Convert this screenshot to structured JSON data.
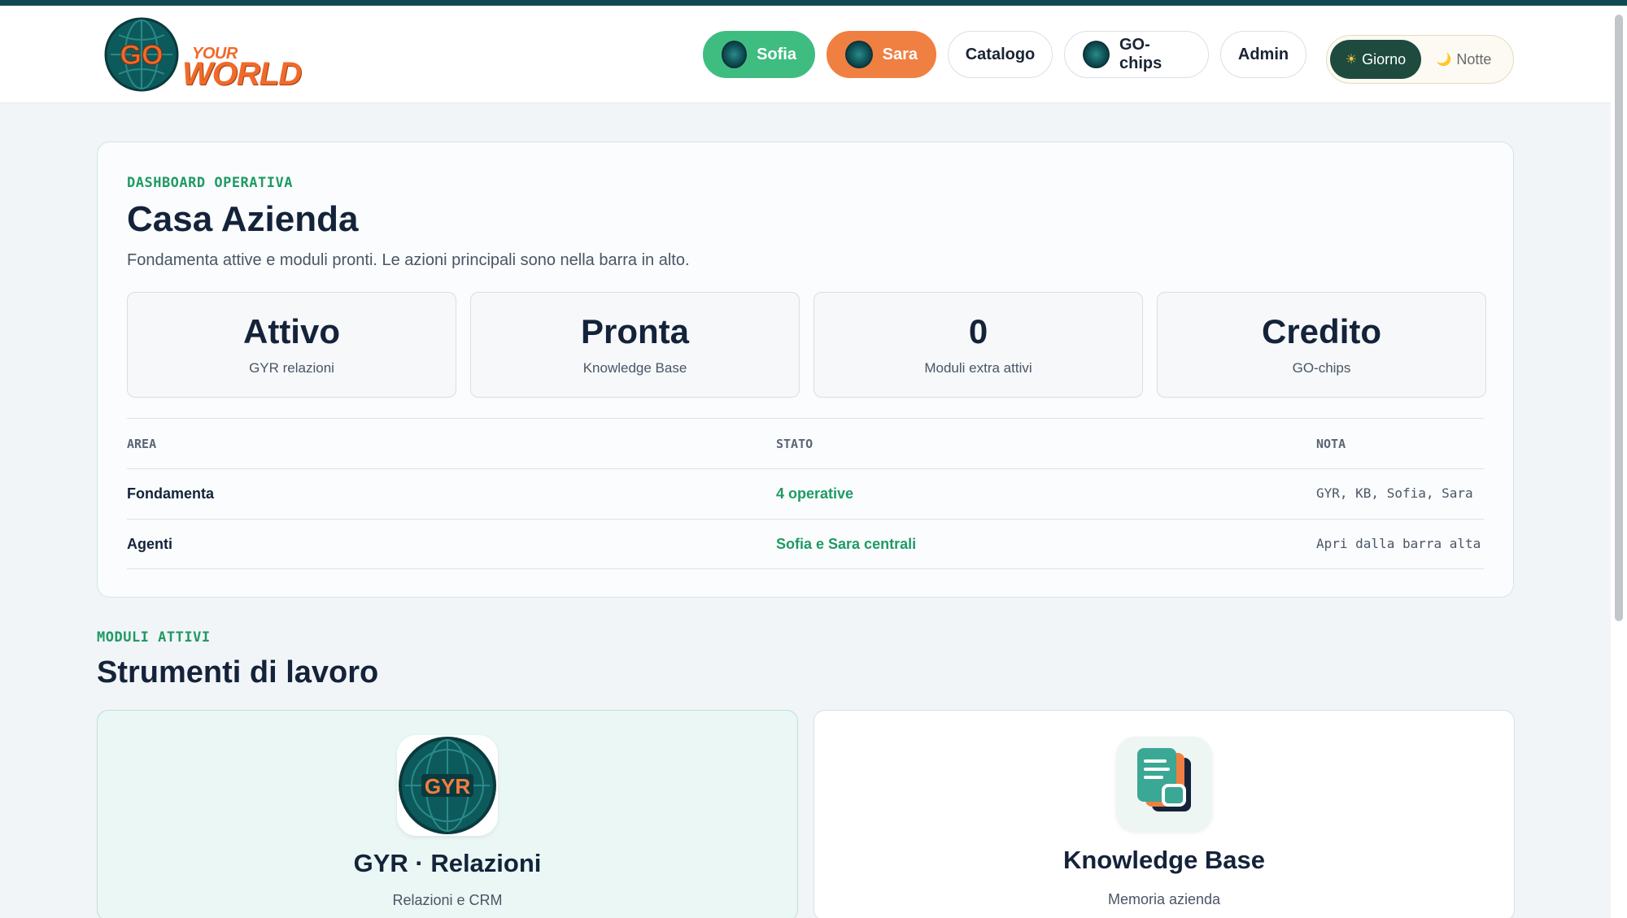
{
  "header": {
    "logo": {
      "line1": "YOUR",
      "line2": "WORLD",
      "globe_text": "GO"
    },
    "nav": [
      {
        "label": "Sofia",
        "avatar": "sofia-avatar-icon"
      },
      {
        "label": "Sara",
        "avatar": "sara-avatar-icon"
      },
      {
        "label": "Catalogo"
      },
      {
        "label": "GO-chips",
        "avatar": "go-chips-icon"
      },
      {
        "label": "Admin"
      }
    ],
    "theme": {
      "day_label": "Giorno",
      "day_icon": "☀",
      "night_label": "Notte",
      "night_icon": "🌙",
      "active": "Giorno"
    }
  },
  "dashboard": {
    "eyebrow": "DASHBOARD OPERATIVA",
    "title": "Casa Azienda",
    "subtitle": "Fondamenta attive e moduli pronti. Le azioni principali sono nella barra in alto.",
    "stats": [
      {
        "value": "Attivo",
        "label": "GYR relazioni"
      },
      {
        "value": "Pronta",
        "label": "Knowledge Base"
      },
      {
        "value": "0",
        "label": "Moduli extra attivi"
      },
      {
        "value": "Credito",
        "label": "GO-chips"
      }
    ],
    "table": {
      "headers": [
        "AREA",
        "STATO",
        "NOTA"
      ],
      "rows": [
        {
          "area": "Fondamenta",
          "stato": "4 operative",
          "nota": "GYR, KB, Sofia, Sara"
        },
        {
          "area": "Agenti",
          "stato": "Sofia e Sara centrali",
          "nota": "Apri dalla barra alta"
        }
      ]
    }
  },
  "modules_section": {
    "eyebrow": "MODULI ATTIVI",
    "title": "Strumenti di lavoro",
    "modules": [
      {
        "name": "GYR · Relazioni",
        "desc": "Relazioni e CRM",
        "icon": "gyr-globe-icon",
        "icon_text": "GYR"
      },
      {
        "name": "Knowledge Base",
        "desc": "Memoria azienda",
        "icon": "knowledge-base-icon"
      }
    ]
  },
  "colors": {
    "accent_green": "#3fbd80",
    "accent_orange": "#f07f42",
    "brand_dark": "#0f4a52",
    "text_green": "#1f9a64"
  }
}
